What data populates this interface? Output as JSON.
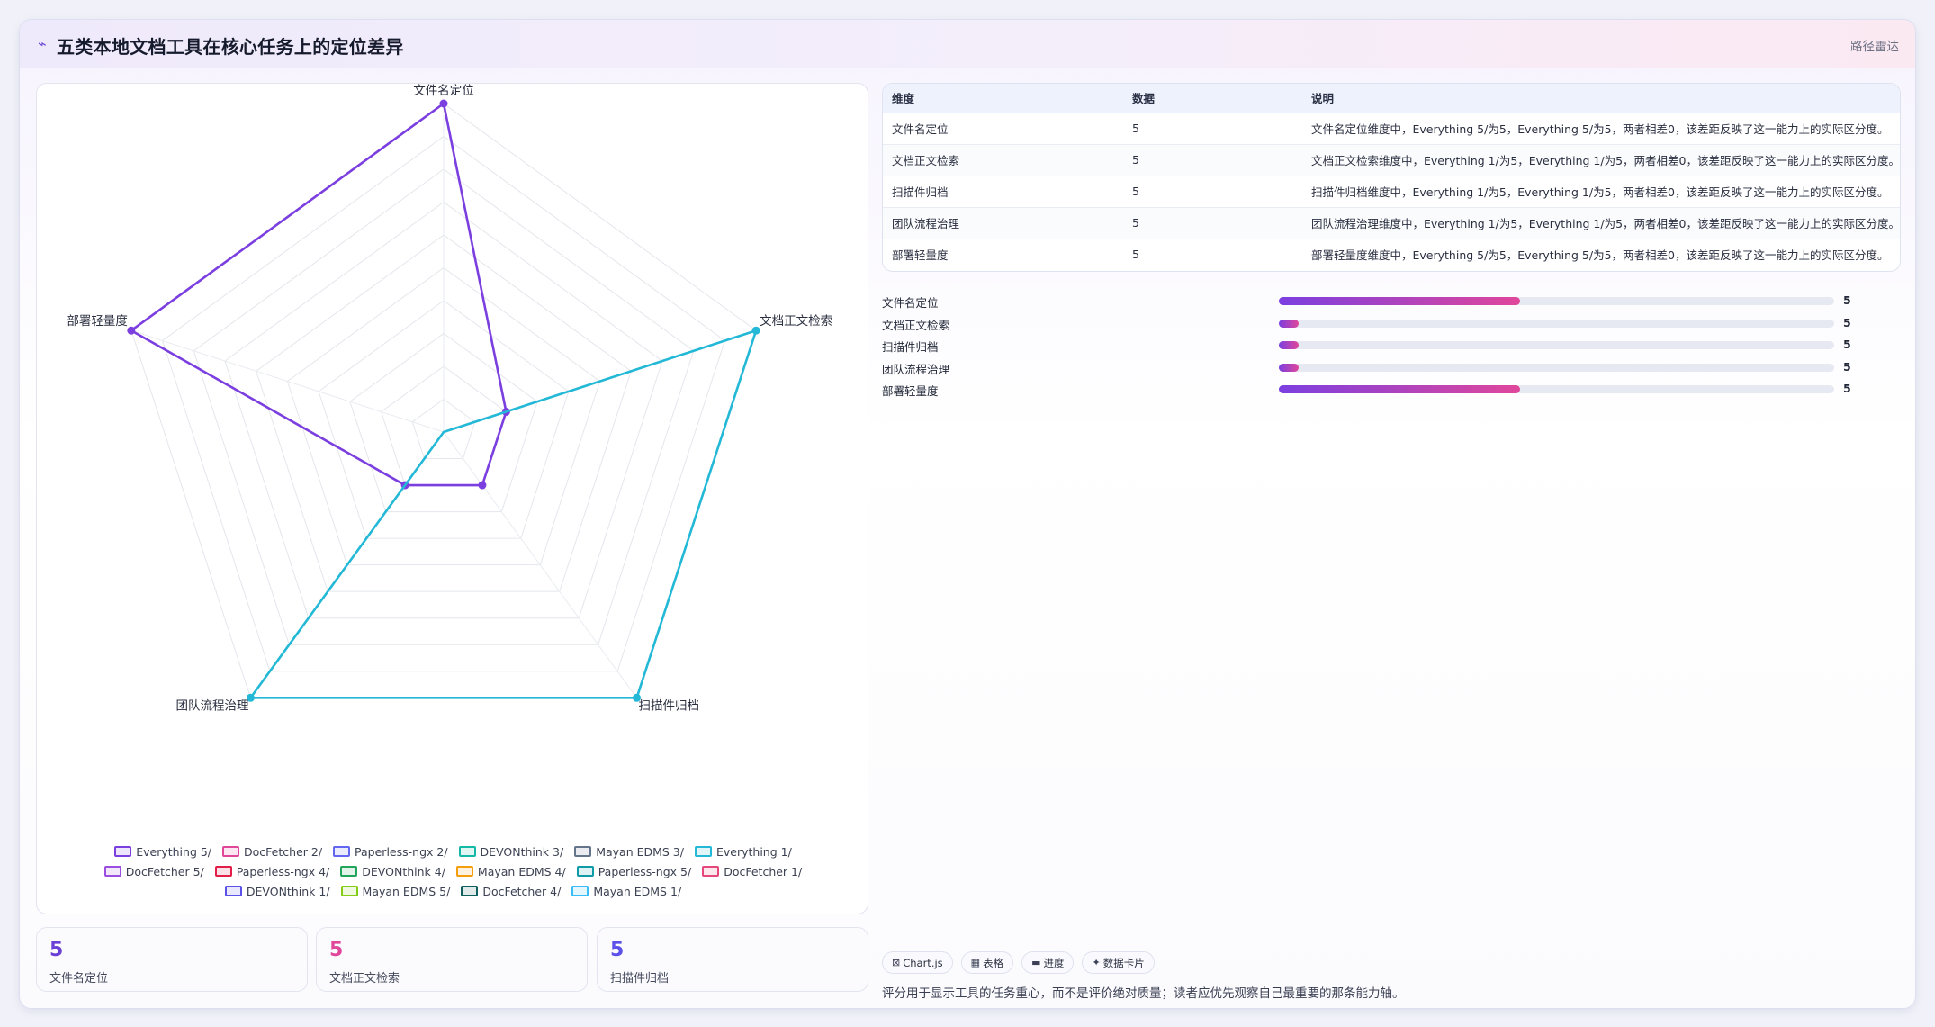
{
  "header": {
    "icon": "chart-line-icon",
    "title": "五类本地文档工具在核心任务上的定位差异",
    "right_label": "路径雷达"
  },
  "chart_data": {
    "type": "radar",
    "axes": [
      "文件名定位",
      "文档正文检索",
      "扫描件归档",
      "团队流程治理",
      "部署轻量度"
    ],
    "scale": {
      "min": 0,
      "max": 5,
      "grid_rings": 10
    },
    "series": [
      {
        "name": "Everything 5/",
        "color": "#7b3fe0",
        "values": [
          5,
          1,
          1,
          1,
          5
        ]
      },
      {
        "name": "DocFetcher 2/",
        "color": "#e0479b",
        "values": [
          0,
          0,
          0,
          0,
          0
        ]
      },
      {
        "name": "Paperless-ngx 2/",
        "color": "#6366f1",
        "values": [
          0,
          0,
          0,
          0,
          0
        ]
      },
      {
        "name": "DEVONthink 3/",
        "color": "#14b8a6",
        "values": [
          0,
          0,
          0,
          0,
          0
        ]
      },
      {
        "name": "Mayan EDMS 3/",
        "color": "#64748b",
        "values": [
          0,
          0,
          0,
          0,
          0
        ]
      },
      {
        "name": "Everything 1/",
        "color": "#22b8d6",
        "values": [
          0,
          5,
          5,
          5,
          0
        ]
      },
      {
        "name": "DocFetcher 5/",
        "color": "#9b4de0",
        "values": [
          0,
          0,
          0,
          0,
          0
        ]
      },
      {
        "name": "Paperless-ngx 4/",
        "color": "#e11d48",
        "values": [
          0,
          0,
          0,
          0,
          0
        ]
      },
      {
        "name": "DEVONthink 4/",
        "color": "#22a55a",
        "values": [
          0,
          0,
          0,
          0,
          0
        ]
      },
      {
        "name": "Mayan EDMS 4/",
        "color": "#f59e0b",
        "values": [
          0,
          0,
          0,
          0,
          0
        ]
      },
      {
        "name": "Paperless-ngx 5/",
        "color": "#0e9aa7",
        "values": [
          0,
          0,
          0,
          0,
          0
        ]
      },
      {
        "name": "DocFetcher 1/",
        "color": "#e5487b",
        "values": [
          0,
          0,
          0,
          0,
          0
        ]
      },
      {
        "name": "DEVONthink 1/",
        "color": "#5b50e8",
        "values": [
          0,
          0,
          0,
          0,
          0
        ]
      },
      {
        "name": "Mayan EDMS 5/",
        "color": "#84cc16",
        "values": [
          0,
          0,
          0,
          0,
          0
        ]
      },
      {
        "name": "DocFetcher 4/",
        "color": "#0f5f5c",
        "values": [
          0,
          0,
          0,
          0,
          0
        ]
      },
      {
        "name": "Mayan EDMS 1/",
        "color": "#38bdf8",
        "values": [
          0,
          0,
          0,
          0,
          0
        ]
      }
    ],
    "legend_placement": "bottom",
    "grid": true
  },
  "table": {
    "headers": [
      "维度",
      "数据",
      "说明"
    ],
    "rows": [
      [
        "文件名定位",
        "5",
        "文件名定位维度中，Everything 5/为5，Everything 5/为5，两者相差0，该差距反映了这一能力上的实际区分度。"
      ],
      [
        "文档正文检索",
        "5",
        "文档正文检索维度中，Everything 1/为5，Everything 1/为5，两者相差0，该差距反映了这一能力上的实际区分度。"
      ],
      [
        "扫描件归档",
        "5",
        "扫描件归档维度中，Everything 1/为5，Everything 1/为5，两者相差0，该差距反映了这一能力上的实际区分度。"
      ],
      [
        "团队流程治理",
        "5",
        "团队流程治理维度中，Everything 1/为5，Everything 1/为5，两者相差0，该差距反映了这一能力上的实际区分度。"
      ],
      [
        "部署轻量度",
        "5",
        "部署轻量度维度中，Everything 5/为5，Everything 5/为5，两者相差0，该差距反映了这一能力上的实际区分度。"
      ]
    ]
  },
  "progress": [
    {
      "label": "文件名定位",
      "value": "5",
      "fill": 0.435
    },
    {
      "label": "文档正文检索",
      "value": "5",
      "fill": 0.035
    },
    {
      "label": "扫描件归档",
      "value": "5",
      "fill": 0.035
    },
    {
      "label": "团队流程治理",
      "value": "5",
      "fill": 0.035
    },
    {
      "label": "部署轻量度",
      "value": "5",
      "fill": 0.435
    }
  ],
  "stats": [
    {
      "value": "5",
      "label": "文件名定位",
      "color": "#6a3fd6"
    },
    {
      "value": "5",
      "label": "文档正文检索",
      "color": "#e0479b"
    },
    {
      "value": "5",
      "label": "扫描件归档",
      "color": "#5b50e8"
    }
  ],
  "chips": [
    {
      "icon": "chart-icon",
      "glyph": "⊠",
      "label": "Chart.js"
    },
    {
      "icon": "table-icon",
      "glyph": "▦",
      "label": "表格"
    },
    {
      "icon": "progress-icon",
      "glyph": "▬",
      "label": "进度"
    },
    {
      "icon": "card-icon",
      "glyph": "✦",
      "label": "数据卡片"
    }
  ],
  "footnote": "评分用于显示工具的任务重心，而不是评价绝对质量；读者应优先观察自己最重要的那条能力轴。"
}
